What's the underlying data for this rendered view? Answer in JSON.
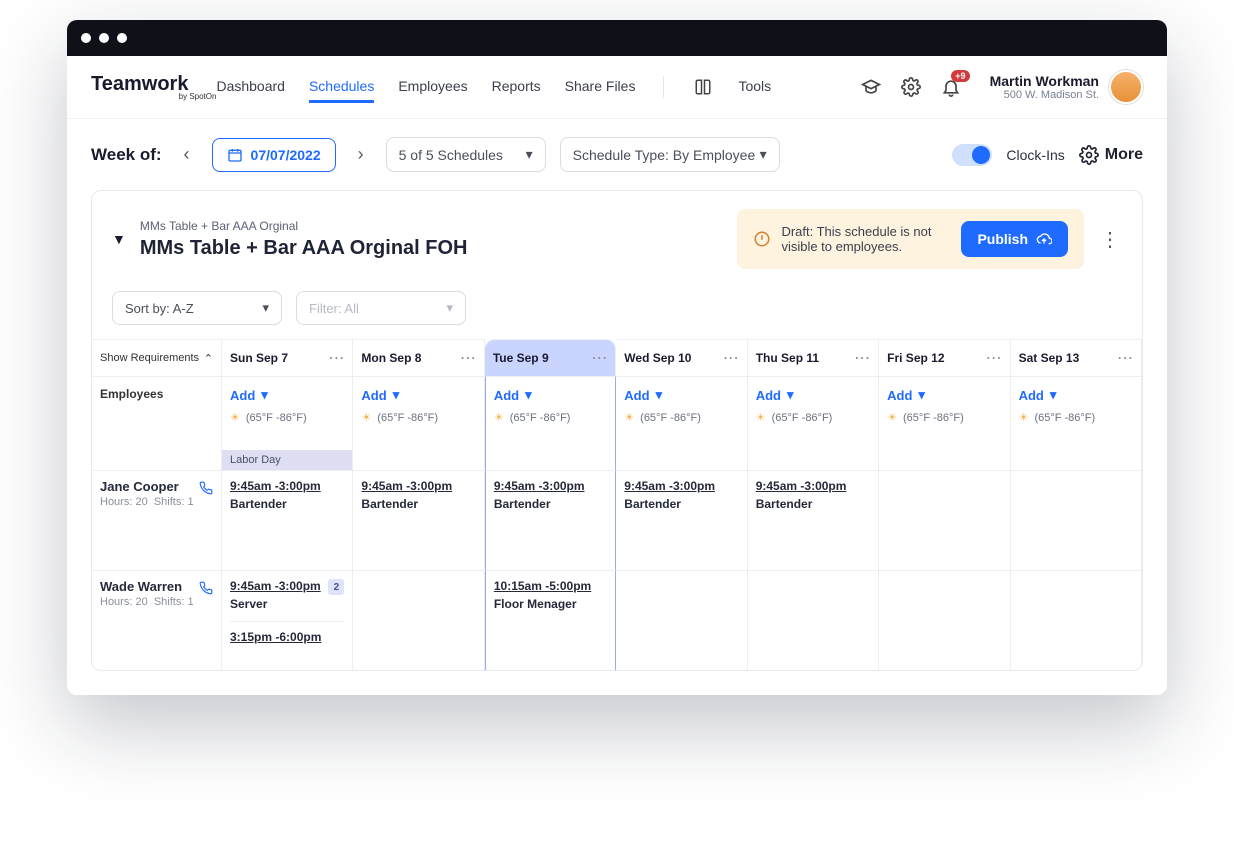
{
  "brand": {
    "name": "Teamwork",
    "byline": "by SpotOn"
  },
  "nav": {
    "dashboard": "Dashboard",
    "schedules": "Schedules",
    "employees": "Employees",
    "reports": "Reports",
    "share": "Share Files",
    "tools": "Tools"
  },
  "badge_count": "+9",
  "user": {
    "name": "Martin Workman",
    "sub": "500 W. Madison St."
  },
  "toolbar": {
    "week_label": "Week of:",
    "date": "07/07/2022",
    "schedules_select": "5 of 5 Schedules",
    "type_select": "Schedule Type: By Employee",
    "toggle_label": "Clock-Ins",
    "more": "More"
  },
  "panel": {
    "breadcrumb": "MMs Table + Bar AAA Orginal",
    "title": "MMs Table + Bar AAA Orginal FOH",
    "draft_text": "Draft: This schedule is not visible to employees.",
    "publish": "Publish"
  },
  "filters": {
    "sort": "Sort by: A-Z",
    "filter": "Filter: All"
  },
  "show_req": "Show Requirements",
  "days": [
    {
      "label": "Sun Sep 7"
    },
    {
      "label": "Mon Sep 8"
    },
    {
      "label": "Tue Sep 9",
      "active": true
    },
    {
      "label": "Wed Sep 10"
    },
    {
      "label": "Thu Sep 11"
    },
    {
      "label": "Fri Sep 12"
    },
    {
      "label": "Sat Sep 13"
    }
  ],
  "employees_header": "Employees",
  "add_label": "Add",
  "weather": "(65°F -86°F)",
  "holiday": "Labor Day",
  "rows": [
    {
      "name": "Jane Cooper",
      "hours": "Hours: 20",
      "shifts": "Shifts: 1",
      "cells": [
        {
          "time": "9:45am -3:00pm",
          "role": "Bartender"
        },
        {
          "time": "9:45am -3:00pm",
          "role": "Bartender"
        },
        {
          "time": "9:45am -3:00pm",
          "role": "Bartender"
        },
        {
          "time": "9:45am -3:00pm",
          "role": "Bartender"
        },
        {
          "time": "9:45am -3:00pm",
          "role": "Bartender"
        },
        {},
        {}
      ]
    },
    {
      "name": "Wade Warren",
      "hours": "Hours: 20",
      "shifts": "Shifts: 1",
      "cells": [
        {
          "time": "9:45am -3:00pm",
          "role": "Server",
          "badge": "2",
          "extra_time": "3:15pm -6:00pm"
        },
        {},
        {
          "time": "10:15am -5:00pm",
          "role": "Floor Menager"
        },
        {},
        {},
        {},
        {}
      ]
    }
  ]
}
